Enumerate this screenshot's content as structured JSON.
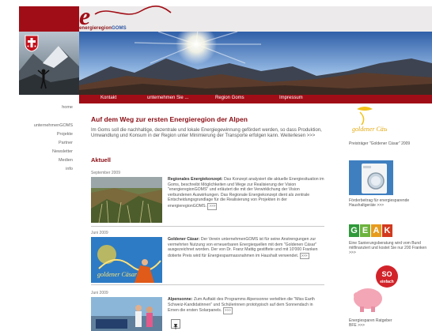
{
  "header": {
    "logo_letter": "e",
    "logo_text_a": "energieregion",
    "logo_text_b": "GOMS"
  },
  "nav": {
    "items": [
      {
        "label": "Kontakt"
      },
      {
        "label": "unternehmen Sie ..."
      },
      {
        "label": "Region Goms"
      },
      {
        "label": "Impressum"
      }
    ]
  },
  "sidebar": {
    "items": [
      {
        "label": "home"
      },
      {
        "label": "unternehmenGOMS"
      },
      {
        "label": "Projekte"
      },
      {
        "label": "Partner"
      },
      {
        "label": "Newsletter"
      },
      {
        "label": "Medien"
      },
      {
        "label": "info"
      }
    ]
  },
  "main": {
    "title": "Auf dem Weg zur ersten Energieregion der Alpen",
    "intro": "Im Goms soll die nachhaltige, dezentrale und lokale Energiegewinnung gefördert werden, so dass Produktion, Umwandlung und Konsum in der Region unter Minimierung der Transporte erfolgen kann. Weiterlesen",
    "intro_more": ">>>",
    "section_title": "Aktuell",
    "news": [
      {
        "date": "September 2009",
        "heading": "Regionales Energiekonzept:",
        "text": "Das Konzept analysiert die aktuelle Energiesituation im Goms, beschreibt Möglichkeiten und Wege zur Realisierung der Vision \"energieregionGOMS\" und erläutert die mit der Verwirklichung der Vision verbundenen Auswirkungen. Das Regionale Energiekonzept dient als zentrale Entscheidungsgrundlage für die Realisierung von Projekten in der energieregionGOMS.",
        "more": ">>>"
      },
      {
        "date": "Juni 2009",
        "heading": "Goldener Cäsar:",
        "text": "Der Verein unternehmenGOMS ist für seine Anstrengungen zur vermehrten Nutzung von erneuerbaren Energiequellen mit dem \"Goldenen Cäsar\" ausgezeichnet worden. Der von Dr. Franz Mattig gestiftete und mit 10'000 Franken dotierte Preis wird für Energiesparmassnahmen im Haushalt verwendet.",
        "more": ">>>"
      },
      {
        "date": "Juni 2009",
        "heading": "Alpensonne:",
        "text": "Zum Auftakt des Programms Alpensonne verteilten die \"Miss Earth Schweiz-Kandidatinnen\" und Schülerinnen prototypisch auf dem Sonnendach in Ernen die ersten Solarpanels.",
        "more": ">>>"
      }
    ]
  },
  "right": {
    "items": [
      {
        "caption": "Preisträger \"Goldener Cäsar\" 2009",
        "more": ""
      },
      {
        "caption": "Förderbeitrag für energiesparende Haushaltgeräte",
        "more": ">>>"
      },
      {
        "caption": "Eine Sanierungsberatung wird vom Bund mitfinanziert und kostet Sie nur 200 Franken",
        "more": ">>>"
      },
      {
        "caption": "Energiesparen Ratgeber BFE",
        "more": ">>>"
      }
    ],
    "geak_letters": [
      "G",
      "E",
      "A",
      "K"
    ],
    "so_badge_a": "SO",
    "so_badge_b": "einfach",
    "caesar_script": "goldener Cäsar"
  },
  "colors": {
    "brand_red": "#a10d16",
    "link_red": "#8a0d14",
    "geak_colors": [
      "#2f9a3a",
      "#6cb33e",
      "#e79b1d",
      "#d23a1e"
    ]
  }
}
